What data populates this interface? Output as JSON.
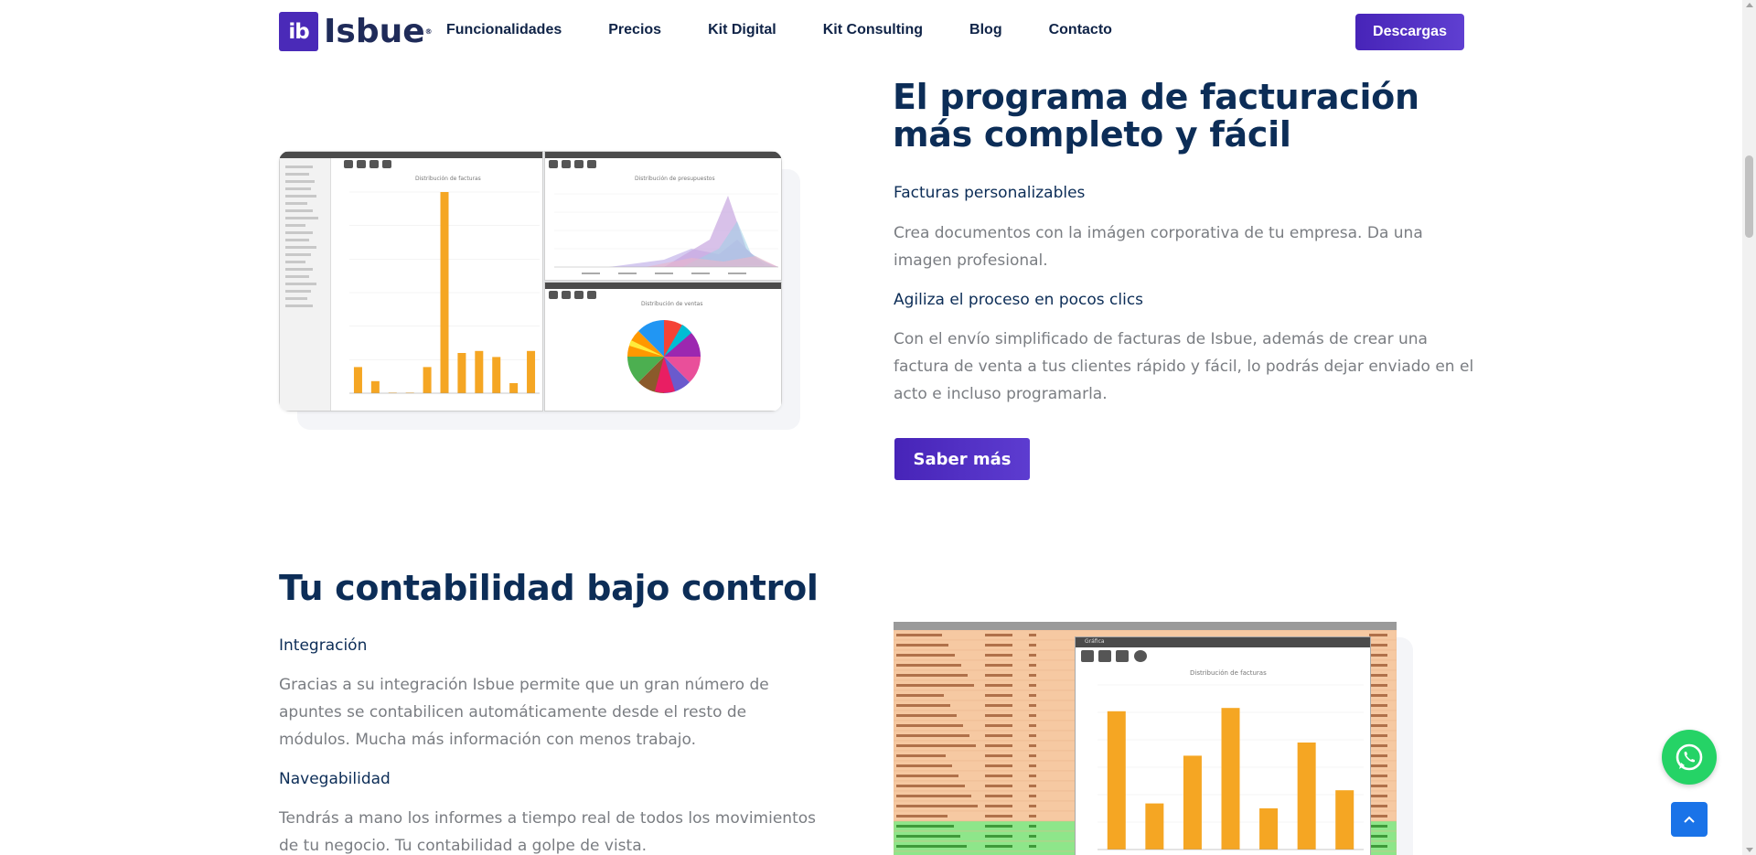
{
  "nav": {
    "logo_mark": "ib",
    "logo_text": "Isbue",
    "links": [
      "Funcionalidades",
      "Precios",
      "Kit Digital",
      "Kit Consulting",
      "Blog",
      "Contacto"
    ],
    "download_label": "Descargas"
  },
  "section1": {
    "title": "El programa de facturación más completo y fácil",
    "feature1_title": "Facturas personalizables",
    "feature1_text": "Crea documentos con la imágen corporativa de tu empresa. Da una imagen profesional.",
    "feature2_title": "Agiliza el proceso en pocos clics",
    "feature2_text": "Con el envío simplificado de facturas de Isbue, además de crear una factura de venta a tus clientes rápido y fácil, lo podrás dejar enviado en el acto e incluso programarla.",
    "more_label": "Saber más",
    "screenshot": {
      "bar_chart_title": "Distribución de facturas",
      "area_chart_title": "Distribución de presupuestos",
      "pie_chart_title": "Distribución de ventas",
      "bar_values": [
        0.13,
        0.06,
        0.0,
        0.0,
        0.13,
        1.0,
        0.2,
        0.21,
        0.18,
        0.05,
        0.21
      ],
      "bar_color": "#f5a623"
    }
  },
  "section2": {
    "title": "Tu contabilidad bajo control",
    "feature1_title": "Integración",
    "feature1_text": "Gracias a su integración Isbue permite que un gran número de apuntes se contabilicen automáticamente desde el resto de módulos. Mucha más información con menos trabajo.",
    "feature2_title": "Navegabilidad",
    "feature2_text": "Tendrás a mano los informes a tiempo real de todos los movimientos de tu negocio. Tu contabilidad a golpe de vista.",
    "screenshot": {
      "chart_title": "Distribución de facturas",
      "window_title": "Gráfica",
      "bar_values": [
        0.84,
        0.28,
        0.57,
        0.86,
        0.25,
        0.65,
        0.36
      ],
      "bar_color": "#f5a623",
      "row_color_orange": "#f6c9a2",
      "row_color_green": "#8ee68a"
    }
  },
  "floating": {
    "whatsapp_icon": "whatsapp-icon",
    "top_icon": "arrow-up-icon"
  },
  "colors": {
    "brand": "#4a2ab8",
    "heading": "#0c2d57",
    "body_text": "#7a7d82",
    "whatsapp": "#25d366",
    "top_button": "#1a73e8"
  }
}
